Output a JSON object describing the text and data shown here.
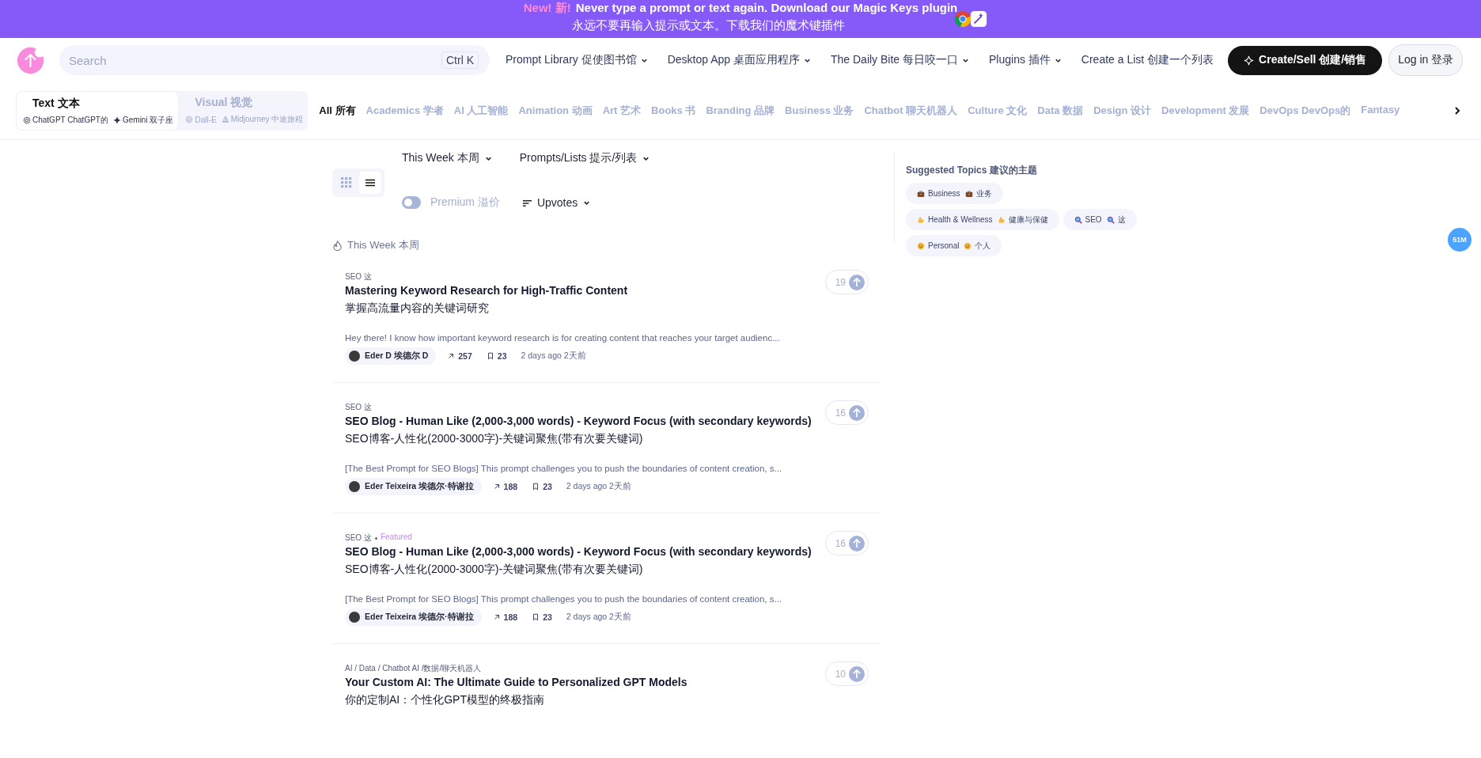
{
  "banner": {
    "new_label": "New! 新!",
    "headline": "Never type a prompt or text again. Download our Magic Keys plugin",
    "subline": "永远不要再输入提示或文本。下载我们的魔术键插件"
  },
  "header": {
    "search": {
      "placeholder": "Search",
      "shortcut": "Ctrl K"
    },
    "nav": [
      {
        "label": "Prompt Library 促使图书馆",
        "dropdown": true
      },
      {
        "label": "Desktop App 桌面应用程序",
        "dropdown": true
      },
      {
        "label": "The Daily Bite 每日咬一口",
        "dropdown": true
      },
      {
        "label": "Plugins 插件",
        "dropdown": true
      },
      {
        "label": "Create a List 创建一个列表",
        "dropdown": false
      }
    ],
    "create_button": "Create/Sell 创建/销售",
    "login_button": "Log in 登录"
  },
  "mode_tabs": [
    {
      "label": "Text 文本",
      "selected": true,
      "models": [
        {
          "kind": "chatgpt",
          "name": "ChatGPT ChatGPT的"
        },
        {
          "kind": "gemini",
          "name": "Gemini 双子座"
        }
      ]
    },
    {
      "label": "Visual 视觉",
      "selected": false,
      "models": [
        {
          "kind": "dalle",
          "name": "Dall-E"
        },
        {
          "kind": "midjourney",
          "name": "Midjourney 中途旅程"
        }
      ]
    }
  ],
  "categories": [
    {
      "label": "All 所有",
      "selected": true
    },
    {
      "label": "Academics 学者",
      "selected": false
    },
    {
      "label": "AI 人工智能",
      "selected": false
    },
    {
      "label": "Animation 动画",
      "selected": false
    },
    {
      "label": "Art 艺术",
      "selected": false
    },
    {
      "label": "Books 书",
      "selected": false
    },
    {
      "label": "Branding 品牌",
      "selected": false
    },
    {
      "label": "Business 业务",
      "selected": false
    },
    {
      "label": "Chatbot 聊天机器人",
      "selected": false
    },
    {
      "label": "Culture 文化",
      "selected": false
    },
    {
      "label": "Data 数据",
      "selected": false
    },
    {
      "label": "Design 设计",
      "selected": false
    },
    {
      "label": "Development 发展",
      "selected": false
    },
    {
      "label": "DevOps DevOps的",
      "selected": false
    },
    {
      "label": "Fantasy",
      "selected": false
    }
  ],
  "filters": {
    "period": "This Week 本周",
    "content_type": "Prompts/Lists 提示/列表",
    "views": [
      {
        "kind": "grid",
        "selected": false
      },
      {
        "kind": "list",
        "selected": true
      }
    ],
    "premium": {
      "label": "Premium 溢价",
      "on": false
    },
    "sort": "Upvotes"
  },
  "section_title": "This Week 本周",
  "prompts": [
    {
      "topic": "SEO 这",
      "title": "Mastering Keyword Research for High-Traffic Content",
      "title_zh": "掌握高流量内容的关键词研究",
      "description": "Hey there! I know how important keyword research is for creating content that reaches your target audienc...",
      "author": "Eder D 埃德尔 D",
      "uses": "257",
      "saves": "23",
      "time": "2 days ago 2天前",
      "upvotes": "19"
    },
    {
      "topic": "SEO 这",
      "title": "SEO Blog - Human Like (2,000-3,000 words) - Keyword Focus (with secondary keywords)",
      "title_zh": "SEO博客-人性化(2000-3000字)-关键词聚焦(带有次要关键词)",
      "description": "[The Best Prompt for SEO Blogs] This prompt challenges you to push the boundaries of content creation, s...",
      "author": "Eder Teixeira 埃德尔·特谢拉",
      "uses": "188",
      "saves": "23",
      "time": "2 days ago 2天前",
      "upvotes": "16"
    },
    {
      "topic": "SEO 这",
      "badge": "Featured",
      "title": "SEO Blog - Human Like (2,000-3,000 words) - Keyword Focus (with secondary keywords)",
      "title_zh": "SEO博客-人性化(2000-3000字)-关键词聚焦(带有次要关键词)",
      "description": "[The Best Prompt for SEO Blogs] This prompt challenges you to push the boundaries of content creation, s...",
      "author": "Eder Teixeira 埃德尔·特谢拉",
      "uses": "188",
      "saves": "23",
      "time": "2 days ago 2天前",
      "upvotes": "16"
    },
    {
      "topic": "AI / Data / Chatbot AI /数据/聊天机器人",
      "title": "Your Custom AI: The Ultimate Guide to Personalized GPT Models",
      "title_zh": "你的定制AI：个性化GPT模型的终极指南",
      "upvotes": "10"
    }
  ],
  "suggested": {
    "title": "Suggested Topics 建议的主题",
    "topics": [
      {
        "kind": "briefcase",
        "label": "Business",
        "label_zh": "业务"
      },
      {
        "kind": "muscle",
        "label": "Health & Wellness",
        "label_zh": "健康与保健"
      },
      {
        "kind": "magnifier",
        "label": "SEO",
        "label_zh": "这"
      },
      {
        "kind": "smiley",
        "label": "Personal",
        "label_zh": "个人"
      }
    ]
  },
  "float_badge": "51M"
}
